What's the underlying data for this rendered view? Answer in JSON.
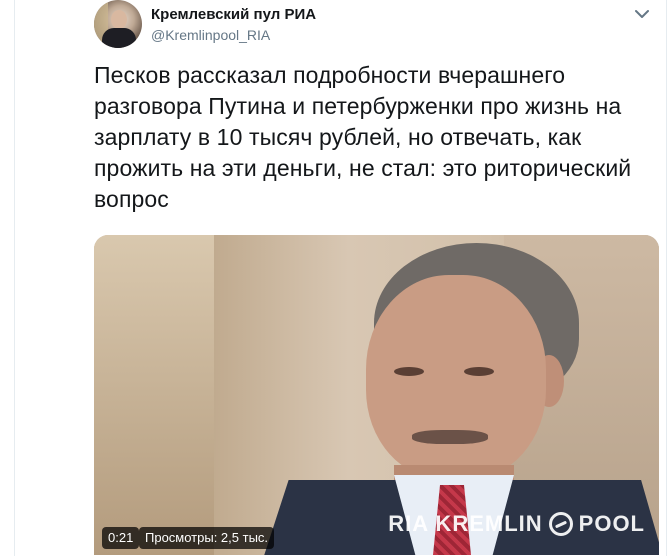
{
  "author": {
    "name": "Кремлевский пул РИА",
    "handle": "@Kremlinpool_RIA",
    "avatar_icon": "profile-photo"
  },
  "tweet": {
    "text": "Песков рассказал подробности вчерашнего разговора Путина и петербурженки про жизнь на зарплату в 10 тысяч рублей, но отвечать, как прожить на эти деньги, не стал: это риторический вопрос"
  },
  "media": {
    "type": "video",
    "watermark": "RIA KREMLIN",
    "watermark_suffix": "POOL",
    "duration": "0:21",
    "views": "Просмотры: 2,5 тыс."
  },
  "menu": {
    "icon": "chevron-down-icon"
  },
  "colors": {
    "text": "#14171a",
    "secondary": "#657786",
    "divider": "#e6ecf0"
  }
}
